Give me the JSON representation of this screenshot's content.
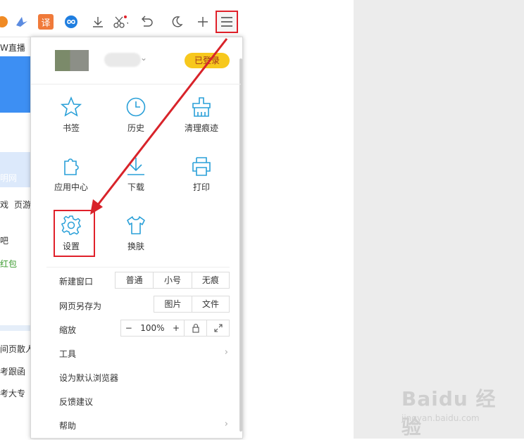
{
  "toolbar": {
    "icons": [
      "orange-app-icon",
      "bird-icon",
      "translate-icon",
      "infinity-icon",
      "download-icon",
      "scissors-icon",
      "undo-icon",
      "moon-icon",
      "plus-icon",
      "menu-icon"
    ],
    "translate_label": "译"
  },
  "background_page": {
    "live_text": "W直播",
    "side_text_1": "明网",
    "side_text_2": "戏",
    "side_text_3": "页游",
    "side_text_4": "吧",
    "side_text_5": "红包",
    "side_text_6": "间页散人",
    "side_text_7": "考跟函",
    "side_text_8": "考大专"
  },
  "menu": {
    "login_badge": "已登录",
    "grid": [
      {
        "label": "书签",
        "icon": "star-icon"
      },
      {
        "label": "历史",
        "icon": "clock-icon"
      },
      {
        "label": "清理痕迹",
        "icon": "broom-icon"
      },
      {
        "label": "应用中心",
        "icon": "puzzle-icon"
      },
      {
        "label": "下载",
        "icon": "download-icon"
      },
      {
        "label": "打印",
        "icon": "printer-icon"
      },
      {
        "label": "设置",
        "icon": "gear-icon"
      },
      {
        "label": "换肤",
        "icon": "shirt-icon"
      }
    ],
    "new_window": {
      "label": "新建窗口",
      "options": [
        "普通",
        "小号",
        "无痕"
      ]
    },
    "save_page": {
      "label": "网页另存为",
      "options": [
        "图片",
        "文件"
      ]
    },
    "zoom": {
      "label": "缩放",
      "minus": "−",
      "value": "100%",
      "plus": "+"
    },
    "tools": "工具",
    "default_browser": "设为默认浏览器",
    "feedback": "反馈建议",
    "help": "帮助"
  },
  "watermark": {
    "brand": "Baidu 经验",
    "sub": "jingyan.baidu.com"
  },
  "colors": {
    "accent": "#2aa0d8",
    "highlight": "#e0202a",
    "badge": "#f7c81d"
  }
}
